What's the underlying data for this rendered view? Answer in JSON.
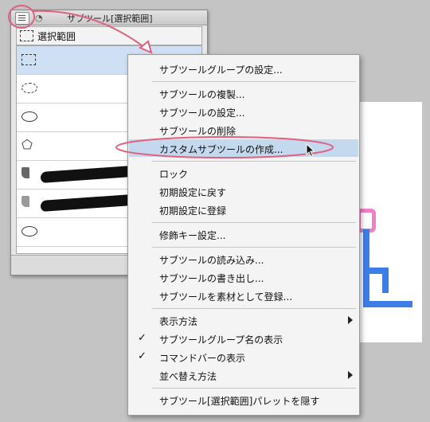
{
  "palette": {
    "title": "サブツール[選択範囲]",
    "group_tab_label": "選択範囲",
    "tools": [
      {
        "icon": "rectangle-selection-icon",
        "selected": true
      },
      {
        "icon": "ellipse-selection-icon",
        "selected": false
      },
      {
        "icon": "lasso-selection-icon",
        "selected": false
      },
      {
        "icon": "polyline-selection-icon",
        "selected": false
      },
      {
        "icon": "selection-pen-icon",
        "selected": false
      },
      {
        "icon": "selection-eraser-icon",
        "selected": false
      },
      {
        "icon": "shrink-selection-icon",
        "selected": false
      }
    ]
  },
  "menu": {
    "items": [
      {
        "label": "サブツールグループの設定..."
      },
      {
        "label": "サブツールの複製..."
      },
      {
        "label": "サブツールの設定..."
      },
      {
        "label": "サブツールの削除"
      },
      {
        "label": "カスタムサブツールの作成...",
        "highlighted": true
      },
      {
        "label": "ロック"
      },
      {
        "label": "初期設定に戻す"
      },
      {
        "label": "初期設定に登録"
      },
      {
        "label": "修飾キー設定..."
      },
      {
        "label": "サブツールの読み込み..."
      },
      {
        "label": "サブツールの書き出し..."
      },
      {
        "label": "サブツールを素材として登録..."
      },
      {
        "label": "表示方法",
        "submenu": true
      },
      {
        "label": "サブツールグループ名の表示",
        "checked": true
      },
      {
        "label": "コマンドバーの表示",
        "checked": true
      },
      {
        "label": "並べ替え方法",
        "submenu": true
      },
      {
        "label": "サブツール[選択範囲]パレットを隠す"
      }
    ]
  },
  "colors": {
    "highlight": "#c4d8ee",
    "annotation": "#e0607e",
    "canvas_stroke_blue": "#3d7de6",
    "canvas_stroke_pink": "#f07fc4"
  }
}
